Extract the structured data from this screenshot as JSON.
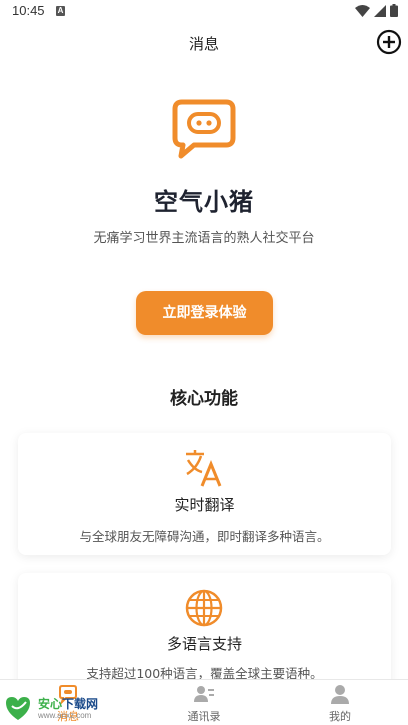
{
  "status_bar": {
    "time": "10:45",
    "notification_letter": "A"
  },
  "header": {
    "title": "消息"
  },
  "hero": {
    "app_name": "空气小猪",
    "slogan": "无痛学习世界主流语言的熟人社交平台"
  },
  "login_button": {
    "label": "立即登录体验"
  },
  "core": {
    "title": "核心功能",
    "features": [
      {
        "icon": "translate-icon",
        "title": "实时翻译",
        "desc": "与全球朋友无障碍沟通，即时翻译多种语言。"
      },
      {
        "icon": "globe-icon",
        "title": "多语言支持",
        "desc": "支持超过100种语言，覆盖全球主要语种。"
      }
    ]
  },
  "bottom_nav": {
    "items": [
      {
        "label": "消息",
        "icon": "chat-bubble-icon"
      },
      {
        "label": "通讯录",
        "icon": "contacts-icon"
      },
      {
        "label": "我的",
        "icon": "user-icon"
      }
    ]
  },
  "watermark": {
    "brand_part1": "安心",
    "brand_part2": "下载网",
    "url": "www.anxz.com"
  },
  "colors": {
    "accent": "#f08c2b",
    "title_dark": "#1f2330",
    "watermark_green": "#1a7a3a"
  }
}
